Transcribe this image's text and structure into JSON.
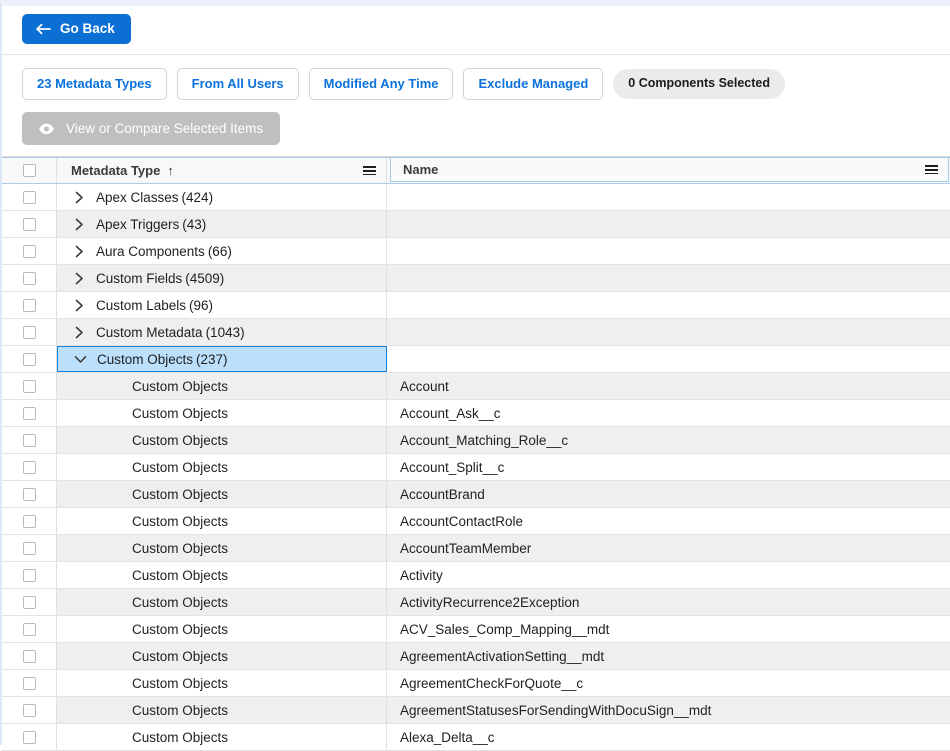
{
  "topbar": {
    "go_back_label": "Go Back",
    "back_arrow_icon": "arrow-left-icon"
  },
  "filters": {
    "chips": [
      {
        "label": "23 Metadata Types",
        "name": "filter-metadata-types"
      },
      {
        "label": "From All Users",
        "name": "filter-from-all-users"
      },
      {
        "label": "Modified Any Time",
        "name": "filter-modified-any-time"
      },
      {
        "label": "Exclude Managed",
        "name": "filter-exclude-managed"
      }
    ],
    "selection_badge": "0 Components Selected"
  },
  "actions": {
    "compare_label": "View or Compare Selected Items",
    "compare_icon": "eye-icon",
    "compare_disabled": true
  },
  "grid": {
    "columns": [
      {
        "key": "select",
        "label": "",
        "name": "column-select"
      },
      {
        "key": "type",
        "label": "Metadata Type",
        "sort": "↑",
        "menu_icon": "column-menu-icon",
        "name": "column-metadata-type"
      },
      {
        "key": "name",
        "label": "Name",
        "menu_icon": "column-menu-icon",
        "name": "column-name"
      }
    ],
    "rows": [
      {
        "kind": "group",
        "type": "Apex Classes",
        "count": "(424)",
        "name": "",
        "expanded": false,
        "selected": false
      },
      {
        "kind": "group",
        "type": "Apex Triggers",
        "count": "(43)",
        "name": "",
        "expanded": false,
        "selected": false
      },
      {
        "kind": "group",
        "type": "Aura Components",
        "count": "(66)",
        "name": "",
        "expanded": false,
        "selected": false
      },
      {
        "kind": "group",
        "type": "Custom Fields",
        "count": "(4509)",
        "name": "",
        "expanded": false,
        "selected": false
      },
      {
        "kind": "group",
        "type": "Custom Labels",
        "count": "(96)",
        "name": "",
        "expanded": false,
        "selected": false
      },
      {
        "kind": "group",
        "type": "Custom Metadata",
        "count": "(1043)",
        "name": "",
        "expanded": false,
        "selected": false
      },
      {
        "kind": "group",
        "type": "Custom Objects",
        "count": "(237)",
        "name": "",
        "expanded": true,
        "selected": true
      },
      {
        "kind": "item",
        "type": "Custom Objects",
        "count": "",
        "name": "Account",
        "expanded": false,
        "selected": false
      },
      {
        "kind": "item",
        "type": "Custom Objects",
        "count": "",
        "name": "Account_Ask__c",
        "expanded": false,
        "selected": false
      },
      {
        "kind": "item",
        "type": "Custom Objects",
        "count": "",
        "name": "Account_Matching_Role__c",
        "expanded": false,
        "selected": false
      },
      {
        "kind": "item",
        "type": "Custom Objects",
        "count": "",
        "name": "Account_Split__c",
        "expanded": false,
        "selected": false
      },
      {
        "kind": "item",
        "type": "Custom Objects",
        "count": "",
        "name": "AccountBrand",
        "expanded": false,
        "selected": false
      },
      {
        "kind": "item",
        "type": "Custom Objects",
        "count": "",
        "name": "AccountContactRole",
        "expanded": false,
        "selected": false
      },
      {
        "kind": "item",
        "type": "Custom Objects",
        "count": "",
        "name": "AccountTeamMember",
        "expanded": false,
        "selected": false
      },
      {
        "kind": "item",
        "type": "Custom Objects",
        "count": "",
        "name": "Activity",
        "expanded": false,
        "selected": false
      },
      {
        "kind": "item",
        "type": "Custom Objects",
        "count": "",
        "name": "ActivityRecurrence2Exception",
        "expanded": false,
        "selected": false
      },
      {
        "kind": "item",
        "type": "Custom Objects",
        "count": "",
        "name": "ACV_Sales_Comp_Mapping__mdt",
        "expanded": false,
        "selected": false
      },
      {
        "kind": "item",
        "type": "Custom Objects",
        "count": "",
        "name": "AgreementActivationSetting__mdt",
        "expanded": false,
        "selected": false
      },
      {
        "kind": "item",
        "type": "Custom Objects",
        "count": "",
        "name": "AgreementCheckForQuote__c",
        "expanded": false,
        "selected": false
      },
      {
        "kind": "item",
        "type": "Custom Objects",
        "count": "",
        "name": "AgreementStatusesForSendingWithDocuSign__mdt",
        "expanded": false,
        "selected": false
      },
      {
        "kind": "item",
        "type": "Custom Objects",
        "count": "",
        "name": "Alexa_Delta__c",
        "expanded": false,
        "selected": false
      }
    ]
  },
  "colors": {
    "primary_blue": "#0b6fd4",
    "link_blue": "#0b72dd",
    "selected_row_bg": "#bcdffb",
    "selected_row_border": "#1283e0",
    "alt_row_bg": "#efefef",
    "disabled_button_bg": "#bfbfbf"
  }
}
